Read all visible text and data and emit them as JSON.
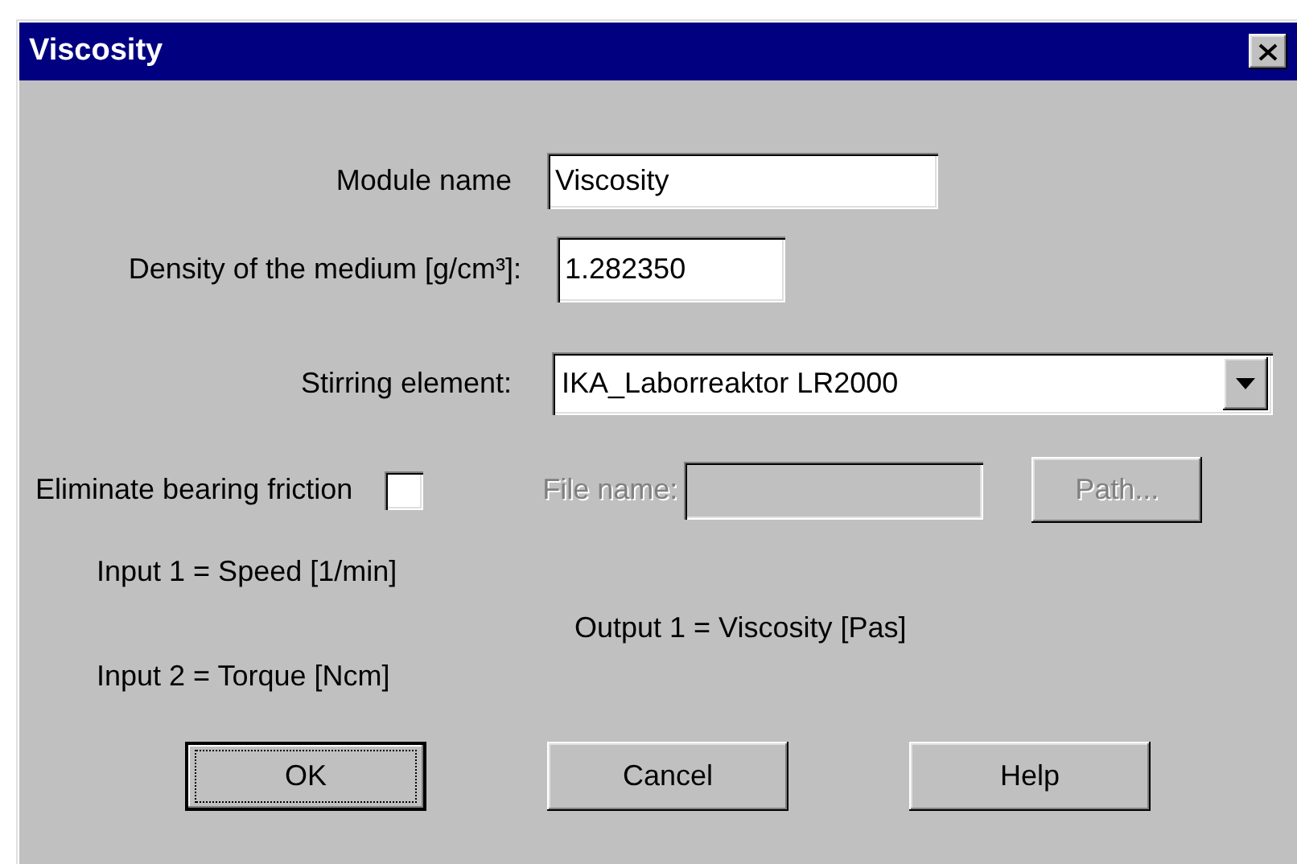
{
  "window": {
    "title": "Viscosity"
  },
  "module_name": {
    "label": "Module name",
    "value": "Viscosity"
  },
  "density": {
    "label": "Density of the medium [g/cm³]:",
    "value": "1.282350"
  },
  "stirring_element": {
    "label": "Stirring element:",
    "value": "IKA_Laborreaktor LR2000"
  },
  "bearing_friction": {
    "label": "Eliminate bearing friction",
    "checked": false
  },
  "file_name": {
    "label": "File name:",
    "disabled": true
  },
  "path_button": {
    "label": "Path...",
    "disabled": true
  },
  "inputs": [
    "Input 1 = Speed [1/min]",
    "Input 2 = Torque [Ncm]"
  ],
  "outputs": [
    "Output 1 = Viscosity [Pas]"
  ],
  "buttons": [
    {
      "label": "OK",
      "default": true
    },
    {
      "label": "Cancel",
      "default": false
    },
    {
      "label": "Help",
      "default": false
    }
  ]
}
